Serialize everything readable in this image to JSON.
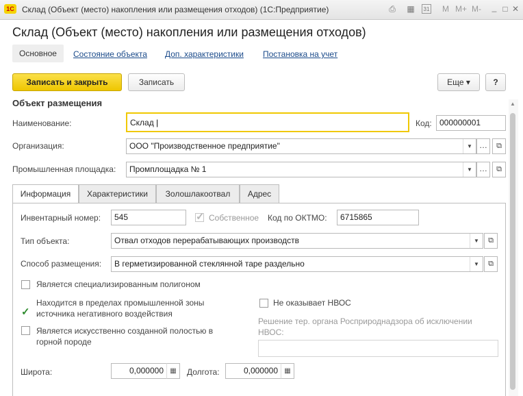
{
  "window": {
    "app_badge": "1С",
    "title": "Склад (Объект (место) накопления или размещения отходов)  (1С:Предприятие)",
    "tb_m": "M",
    "tb_mplus": "M+",
    "tb_mminus": "M-",
    "tb_minimize": "_",
    "tb_maximize": "□",
    "tb_close": "✕",
    "tb_print": "⎙",
    "tb_calc": "▦",
    "tb_calendar": "31"
  },
  "header": {
    "title": "Склад (Объект (место) накопления или размещения отходов)",
    "nav": [
      "Основное",
      "Состояние объекта",
      "Доп. характеристики",
      "Постановка на учет"
    ]
  },
  "toolbar": {
    "save_close": "Записать и закрыть",
    "save": "Записать",
    "more": "Еще ▾",
    "help": "?"
  },
  "form": {
    "section_title": "Объект размещения",
    "name_label": "Наименование:",
    "name_value": "Склад",
    "code_label": "Код:",
    "code_value": "000000001",
    "org_label": "Организация:",
    "org_value": "ООО \"Производственное предприятие\"",
    "site_label": "Промышленная площадка:",
    "site_value": "Промплощадка № 1"
  },
  "tabs": [
    "Информация",
    "Характеристики",
    "Золошлакоотвал",
    "Адрес"
  ],
  "info": {
    "inv_label": "Инвентарный номер:",
    "inv_value": "545",
    "own_label": "Собственное",
    "own_checked": true,
    "oktmo_label": "Код по ОКТМО:",
    "oktmo_value": "6715865",
    "type_label": "Тип объекта:",
    "type_value": "Отвал отходов перерабатывающих производств",
    "method_label": "Способ размещения:",
    "method_value": "В герметизированной стеклянной таре раздельно",
    "cb_polygon": "Является специализированным полигоном",
    "cb_polygon_checked": false,
    "cb_zone": "Находится в пределах промышленной зоны источника негативного воздействия",
    "cb_zone_checked": true,
    "cb_cavity": "Является искусственно созданной полостью в горной породе",
    "cb_cavity_checked": false,
    "cb_nvos": "Не оказывает НВОС",
    "cb_nvos_checked": false,
    "decision_label": "Решение тер. органа Росприроднадзора об исключении НВОС:",
    "decision_value": "",
    "lat_label": "Широта:",
    "lat_value": "0,000000",
    "lon_label": "Долгота:",
    "lon_value": "0,000000"
  },
  "colors": {
    "accent": "#f5d000",
    "link": "#1a4a8a",
    "check": "#2e8b2e"
  },
  "icons": [
    "app-logo-icon",
    "print-icon",
    "calculator-icon",
    "calendar-icon",
    "minimize-icon",
    "maximize-icon",
    "close-icon"
  ]
}
